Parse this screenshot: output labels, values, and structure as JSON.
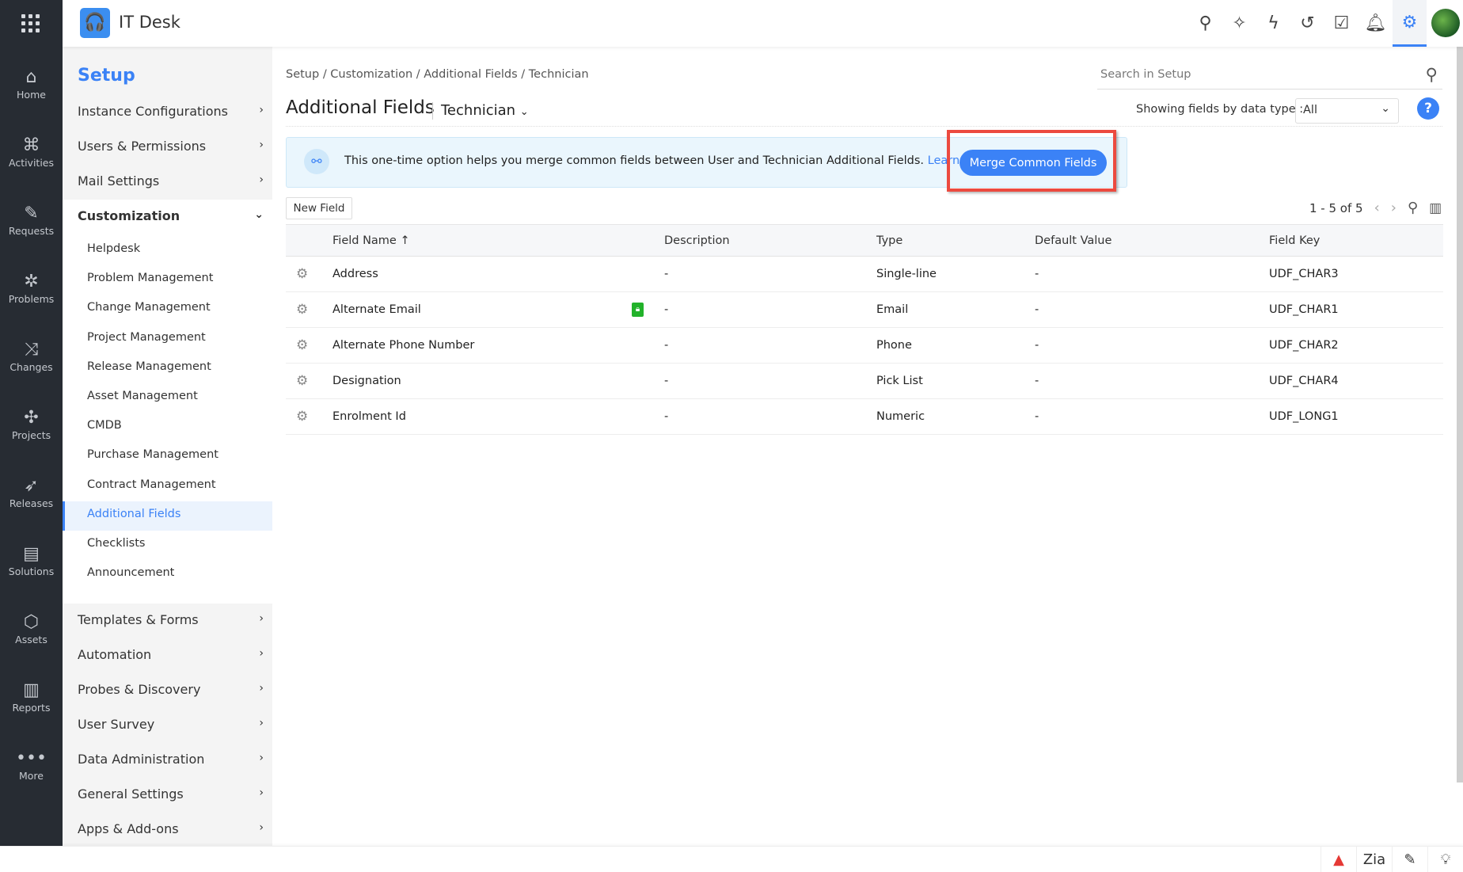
{
  "app": {
    "name": "IT Desk"
  },
  "rail": [
    {
      "label": "Home",
      "icon": "⌂"
    },
    {
      "label": "Activities",
      "icon": "⌘"
    },
    {
      "label": "Requests",
      "icon": "✎"
    },
    {
      "label": "Problems",
      "icon": "✲"
    },
    {
      "label": "Changes",
      "icon": "⤨"
    },
    {
      "label": "Projects",
      "icon": "✣"
    },
    {
      "label": "Releases",
      "icon": "➶"
    },
    {
      "label": "Solutions",
      "icon": "▤"
    },
    {
      "label": "Assets",
      "icon": "⬡"
    },
    {
      "label": "Reports",
      "icon": "▥"
    },
    {
      "label": "More",
      "icon": "•••"
    }
  ],
  "setup": {
    "title": "Setup",
    "top_items": [
      "Instance Configurations",
      "Users & Permissions",
      "Mail Settings"
    ],
    "customization": "Customization",
    "sub_items": [
      "Helpdesk",
      "Problem Management",
      "Change Management",
      "Project Management",
      "Release Management",
      "Asset Management",
      "CMDB",
      "Purchase Management",
      "Contract Management",
      "Additional Fields",
      "Checklists",
      "Announcement"
    ],
    "bottom_items": [
      "Templates & Forms",
      "Automation",
      "Probes & Discovery",
      "User Survey",
      "Data Administration",
      "General Settings",
      "Apps & Add-ons"
    ]
  },
  "main": {
    "breadcrumb": "Setup / Customization / Additional Fields / Technician",
    "search_placeholder": "Search in Setup",
    "title": "Additional Fields",
    "subtitle": "Technician",
    "filter_label": "Showing fields by data type :",
    "filter_value": "All",
    "help": "?",
    "banner_text": "This one-time option helps you merge common fields between User and Technician Additional Fields.",
    "banner_link": "Learn more.",
    "merge_button": "Merge Common Fields",
    "new_field": "New Field",
    "pager": "1 - 5 of 5",
    "columns": [
      "Field Name ↑",
      "Description",
      "Type",
      "Default Value",
      "Field Key"
    ],
    "rows": [
      {
        "name": "Address",
        "desc": "-",
        "type": "Single-line",
        "default": "-",
        "key": "UDF_CHAR3"
      },
      {
        "name": "Alternate Email",
        "desc": "-",
        "type": "Email",
        "default": "-",
        "key": "UDF_CHAR1",
        "locked": true
      },
      {
        "name": "Alternate Phone Number",
        "desc": "-",
        "type": "Phone",
        "default": "-",
        "key": "UDF_CHAR2"
      },
      {
        "name": "Designation",
        "desc": "-",
        "type": "Pick List",
        "default": "-",
        "key": "UDF_CHAR4"
      },
      {
        "name": "Enrolment Id",
        "desc": "-",
        "type": "Numeric",
        "default": "-",
        "key": "UDF_LONG1"
      }
    ]
  },
  "colors": {
    "accent": "#3b82f6",
    "highlight": "#ec4a3f",
    "rail": "#272c33"
  }
}
